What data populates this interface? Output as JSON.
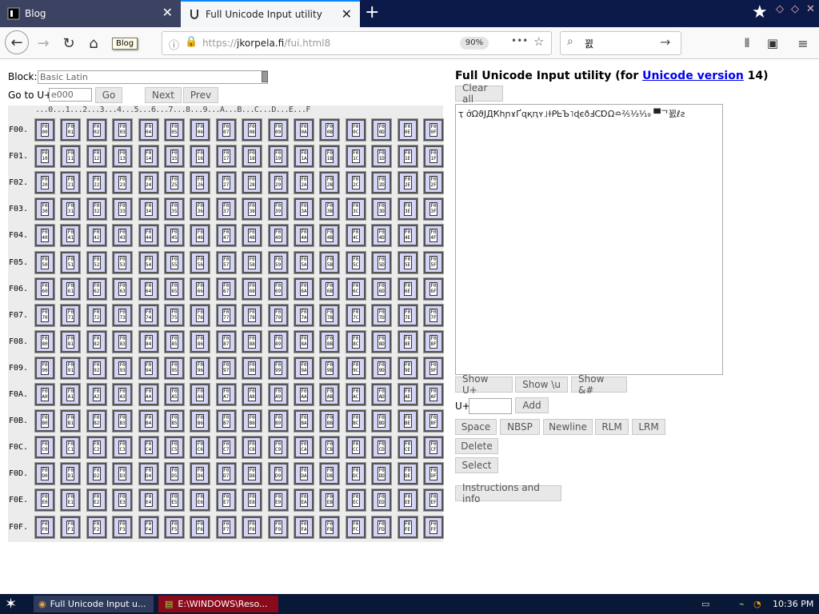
{
  "tabs": [
    {
      "title": "Blog"
    },
    {
      "title": "Full Unicode Input utility"
    }
  ],
  "tooltip": "Blog",
  "url": {
    "prefix": "https://",
    "host": "jkorpela.fi",
    "path": "/fui.html8",
    "zoom": "90%"
  },
  "search": {
    "value": "꾌"
  },
  "block": {
    "label": "Block:",
    "value": "Basic Latin"
  },
  "goto": {
    "label": "Go to U+",
    "value": "e000",
    "go": "Go",
    "next": "Next",
    "prev": "Prev"
  },
  "grid": {
    "header": "...0...1...2...3...4...5...6...7...8...9...A...B...C...D...E...F",
    "columns": [
      "0",
      "1",
      "2",
      "3",
      "4",
      "5",
      "6",
      "7",
      "8",
      "9",
      "A",
      "B",
      "C",
      "D",
      "E",
      "F"
    ],
    "rows": [
      "F00.",
      "F01.",
      "F02.",
      "F03.",
      "F04.",
      "F05.",
      "F06.",
      "F07.",
      "F08.",
      "F09.",
      "F0A.",
      "F0B.",
      "F0C.",
      "F0D.",
      "F0E.",
      "F0F."
    ]
  },
  "page": {
    "title_pre": "Full Unicode Input utility (for ",
    "title_link": "Unicode version",
    "title_post": " 14)"
  },
  "buttons": {
    "clear_all": "Clear all",
    "show_uplus": "Show U+",
    "show_u": "Show \\u",
    "show_amp": "Show &#",
    "uplus_label": "U+",
    "add": "Add",
    "space": "Space",
    "nbsp": "NBSP",
    "newline": "Newline",
    "rlm": "RLM",
    "lrm": "LRM",
    "delete": "Delete",
    "select": "Select",
    "instructions": "Instructions and info"
  },
  "output_text": "ҭ ớΩϑЈДҞհɲɤҐɋқԥʏ˩ɫᑭᖶЪ˥ɖєðℲⅭⱰΩ≏⅖⅓⅟₁₉ ▀ᄀ꾌ℓƨ",
  "taskbar": {
    "items": [
      "Full Unicode Input u...",
      "E:\\WINDOWS\\Reso..."
    ],
    "clock": "10:36 PM"
  },
  "colors": {
    "tabbar": "#0c1a4a",
    "cell": "#d4d4f6",
    "link": "#0000ee",
    "taskbar": "#0a1838"
  },
  "icons": [
    "page-icon",
    "close-icon",
    "plus-icon",
    "star-icon",
    "back-icon",
    "forward-icon",
    "reload-icon",
    "home-icon",
    "info-icon",
    "lock-icon",
    "more-icon",
    "bookmark-star-icon",
    "search-icon",
    "arrow-right-icon",
    "library-icon",
    "sidebar-icon",
    "menu-icon",
    "start-icon",
    "firefox-icon",
    "editor-icon",
    "keyboard-icon",
    "network-icon",
    "speaker-icon"
  ]
}
